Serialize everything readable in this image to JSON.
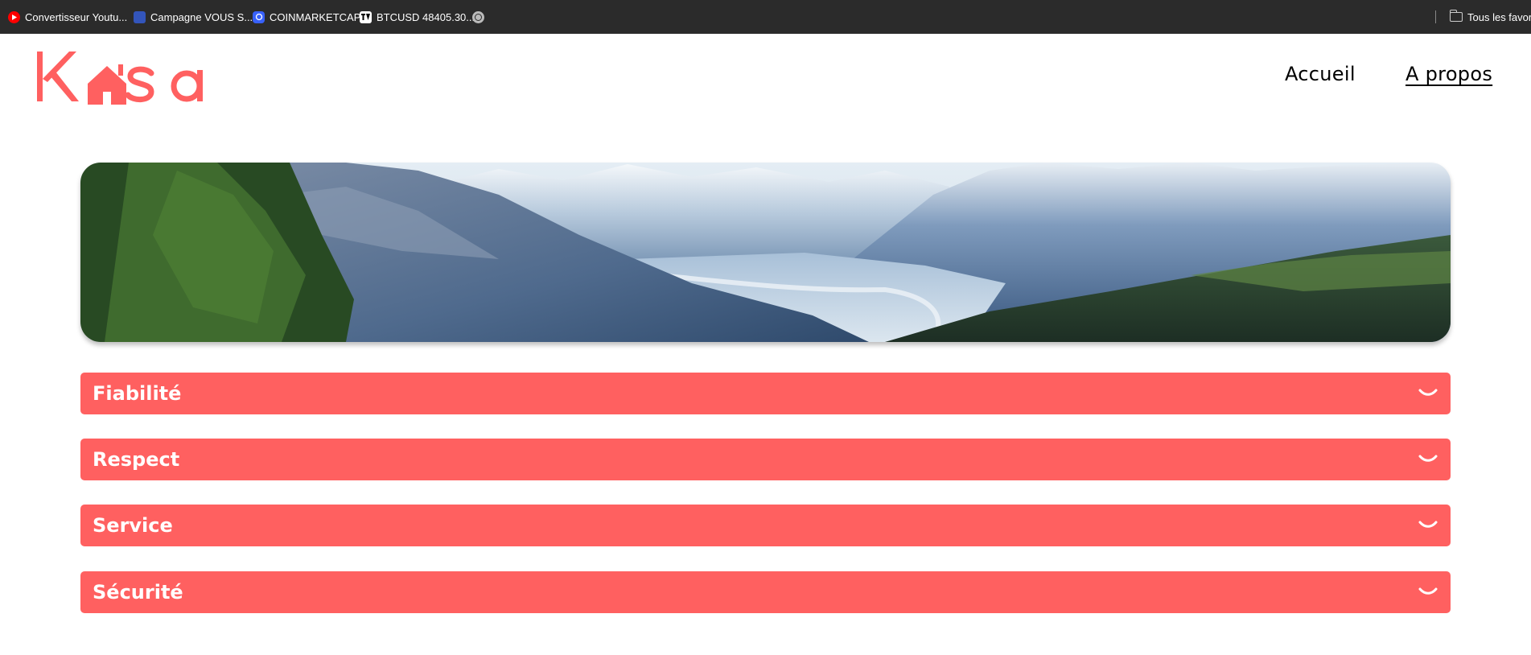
{
  "bookmarks": [
    {
      "label": "Convertisseur Youtu...",
      "icon": "youtube-icon"
    },
    {
      "label": "Campagne VOUS S...",
      "icon": "campaign-icon"
    },
    {
      "label": "COINMARKETCAP",
      "icon": "coinmarketcap-icon"
    },
    {
      "label": "BTCUSD 48405.30...",
      "icon": "tradingview-icon"
    },
    {
      "label": "",
      "icon": "globe-icon"
    }
  ],
  "bookmarks_folder": {
    "label": "Tous les favoris",
    "icon": "folder-icon"
  },
  "logo": {
    "text": "Kasa",
    "color": "#ff6060"
  },
  "nav": {
    "home": "Accueil",
    "about": "A propos"
  },
  "banner": {
    "image": "mountain-valley-landscape"
  },
  "sections": [
    {
      "title": "Fiabilité"
    },
    {
      "title": "Respect"
    },
    {
      "title": "Service"
    },
    {
      "title": "Sécurité"
    }
  ],
  "colors": {
    "accent": "#ff6060",
    "bookmarks_bg": "#2b2b2b",
    "text": "#000000"
  }
}
